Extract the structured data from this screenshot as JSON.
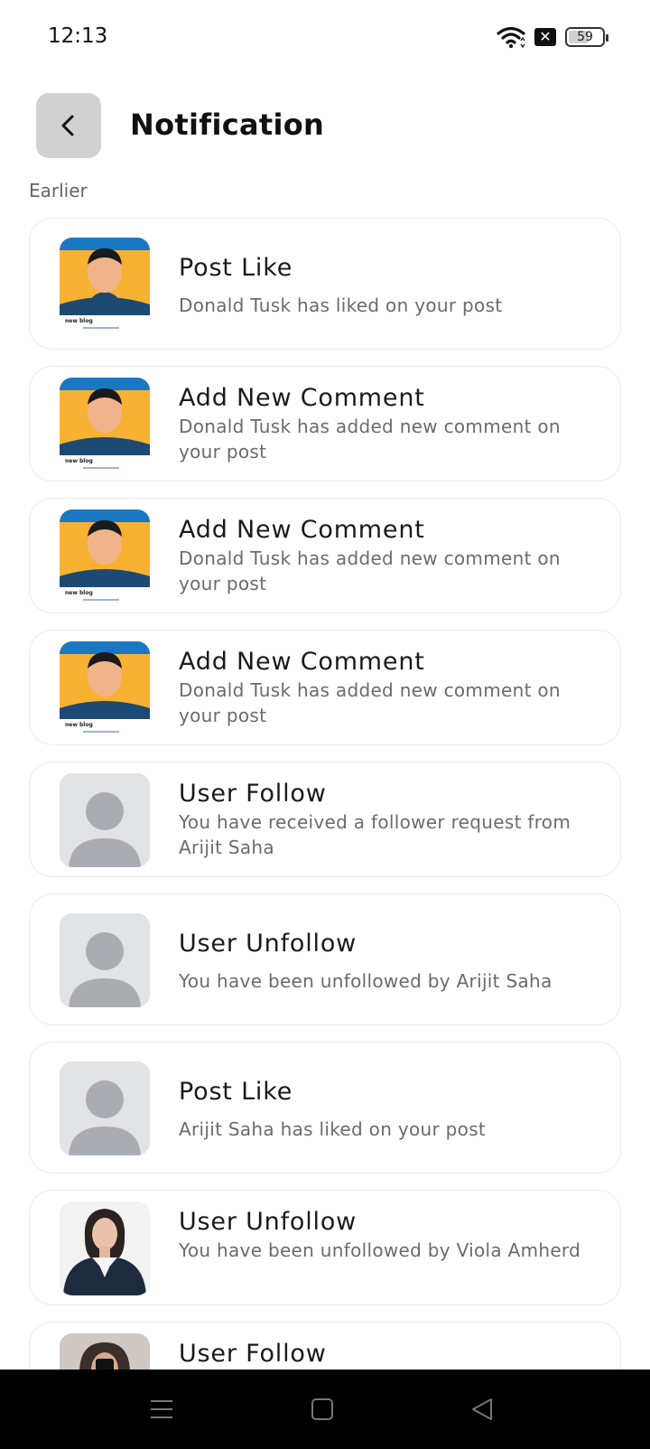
{
  "status": {
    "time": "12:13",
    "battery": "59"
  },
  "header": {
    "title": "Notification"
  },
  "section": {
    "label": "Earlier"
  },
  "notifications": [
    {
      "title": "Post Like",
      "message": "Donald Tusk has liked on your post",
      "thumb": "blog-post-thumbnail",
      "thumb_caption": "new blog"
    },
    {
      "title": "Add New Comment",
      "message": "Donald Tusk has added new comment on your post",
      "thumb": "blog-post-thumbnail",
      "thumb_caption": "new blog"
    },
    {
      "title": "Add New Comment",
      "message": "Donald Tusk has added new comment on your post",
      "thumb": "blog-post-thumbnail",
      "thumb_caption": "new blog"
    },
    {
      "title": "Add New Comment",
      "message": "Donald Tusk has added new comment on your post",
      "thumb": "blog-post-thumbnail",
      "thumb_caption": "new blog"
    },
    {
      "title": "User Follow",
      "message": "You have received a follower request from Arijit Saha",
      "thumb": "default-avatar"
    },
    {
      "title": "User Unfollow",
      "message": "You have been unfollowed by Arijit Saha",
      "thumb": "default-avatar"
    },
    {
      "title": "Post Like",
      "message": "Arijit Saha has liked on your post",
      "thumb": "default-avatar"
    },
    {
      "title": "User Unfollow",
      "message": "You have been unfollowed by Viola Amherd",
      "thumb": "photo-avatar"
    },
    {
      "title": "User Follow",
      "message": "",
      "thumb": "photo-avatar"
    }
  ],
  "icons": {
    "back": "chevron-left-icon",
    "wifi": "wifi-icon",
    "nav_menu": "menu-icon",
    "nav_home": "home-square-icon",
    "nav_back": "back-triangle-icon"
  },
  "colors": {
    "thumb_blue": "#1a78c2",
    "thumb_orange": "#f7b233",
    "avatar_bg": "#e2e3e5",
    "avatar_fg": "#a9adb2"
  }
}
